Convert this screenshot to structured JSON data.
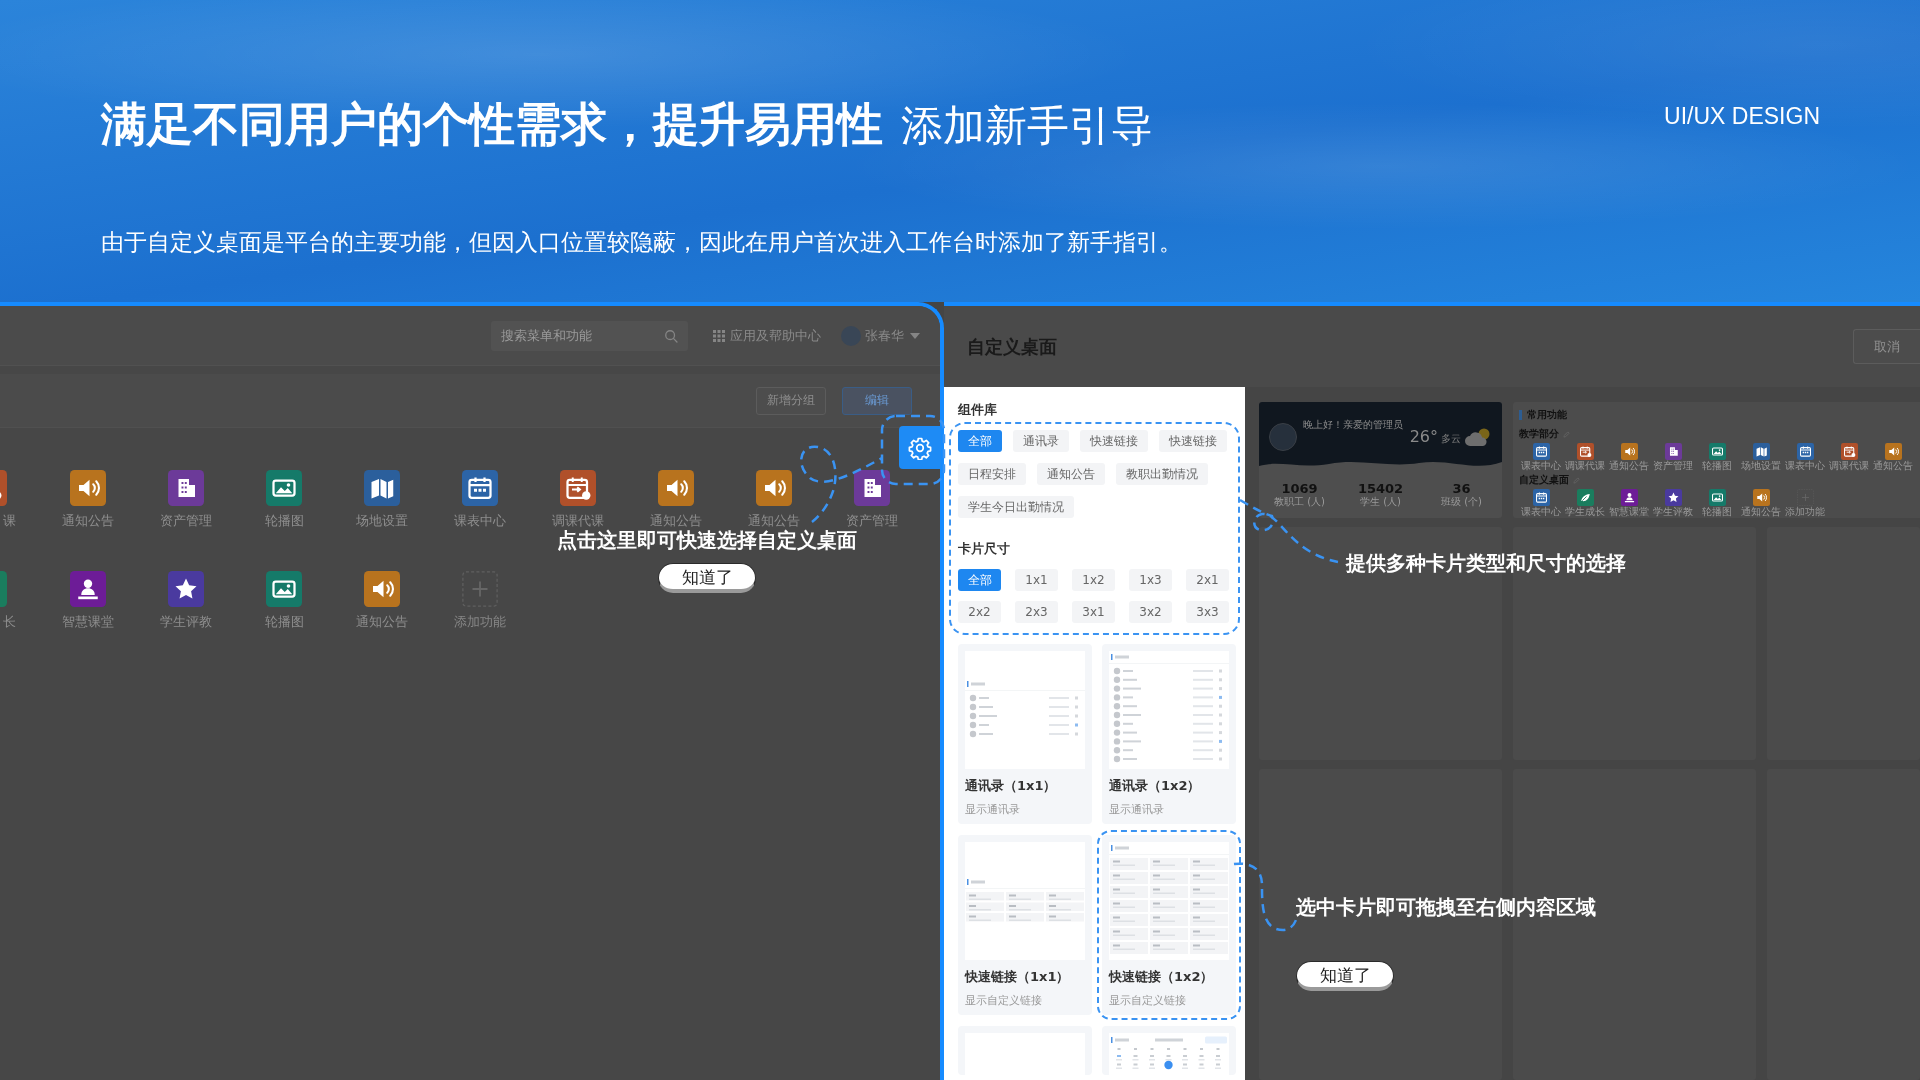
{
  "header": {
    "title": "满足不同用户的个性需求，提升易用性",
    "subtitle": "添加新手引导",
    "tagline": "UI/UX DESIGN",
    "description": "由于自定义桌面是平台的主要功能，但因入口位置较隐蔽，因此在用户首次进入工作台时添加了新手指引。"
  },
  "workbench": {
    "search": {
      "placeholder": "搜索菜单和功能"
    },
    "help_center": "应用及帮助中心",
    "user_name": "张春华",
    "buttons": [
      {
        "label": "新增分组",
        "kind": "default"
      },
      {
        "label": "编辑",
        "kind": "primary"
      }
    ],
    "app_rows": [
      {
        "cut_item": {
          "label": "课",
          "kind": "swap",
          "color": "#b0502a"
        },
        "apps": [
          {
            "label": "通知公告",
            "kind": "speaker",
            "color": "#b8731e"
          },
          {
            "label": "资产管理",
            "kind": "building",
            "color": "#6c3a99"
          },
          {
            "label": "轮播图",
            "kind": "image",
            "color": "#157a69"
          },
          {
            "label": "场地设置",
            "kind": "venue",
            "color": "#2b5f9c"
          },
          {
            "label": "课表中心",
            "kind": "calendar",
            "color": "#2c64a6"
          },
          {
            "label": "调课代课",
            "kind": "swap",
            "color": "#b0502a"
          },
          {
            "label": "通知公告",
            "kind": "speaker",
            "color": "#b8731e"
          },
          {
            "label": "通知公告",
            "kind": "speaker",
            "color": "#b8731e"
          },
          {
            "label": "资产管理",
            "kind": "building",
            "color": "#6c3a99"
          }
        ]
      },
      {
        "cut_item": {
          "label": "长",
          "kind": "growth",
          "color": "#1a7d5e"
        },
        "apps": [
          {
            "label": "智慧课堂",
            "kind": "presenter",
            "color": "#6d1c97"
          },
          {
            "label": "学生评教",
            "kind": "star",
            "color": "#4a3a9f"
          },
          {
            "label": "轮播图",
            "kind": "image",
            "color": "#157a69"
          },
          {
            "label": "通知公告",
            "kind": "speaker",
            "color": "#b8731e"
          },
          {
            "label": "添加功能",
            "kind": "add"
          }
        ]
      }
    ],
    "guide": {
      "text": "点击这里即可快速选择自定义桌面",
      "button": "知道了"
    }
  },
  "customize": {
    "title": "自定义桌面",
    "cancel": "取消",
    "library": {
      "title": "组件库",
      "type_tags": [
        {
          "label": "全部",
          "selected": true
        },
        {
          "label": "通讯录",
          "selected": false
        },
        {
          "label": "快速链接",
          "selected": false
        },
        {
          "label": "快速链接",
          "selected": false
        },
        {
          "label": "日程安排",
          "selected": false
        },
        {
          "label": "通知公告",
          "selected": false
        },
        {
          "label": "教职出勤情况",
          "selected": false
        },
        {
          "label": "学生今日出勤情况",
          "selected": false
        }
      ],
      "size_title": "卡片尺寸",
      "size_tags": [
        {
          "label": "全部",
          "selected": true
        },
        {
          "label": "1x1",
          "selected": false
        },
        {
          "label": "1x2",
          "selected": false
        },
        {
          "label": "1x3",
          "selected": false
        },
        {
          "label": "2x1",
          "selected": false
        },
        {
          "label": "2x2",
          "selected": false
        },
        {
          "label": "2x3",
          "selected": false
        },
        {
          "label": "3x1",
          "selected": false
        },
        {
          "label": "3x2",
          "selected": false
        },
        {
          "label": "3x3",
          "selected": false
        }
      ],
      "cards": [
        {
          "kind": "contacts",
          "title": "通讯录（1x1）",
          "description": "显示通讯录",
          "selected": false
        },
        {
          "kind": "contactlist",
          "title": "通讯录（1x2）",
          "description": "显示通讯录",
          "selected": false
        },
        {
          "kind": "links",
          "title": "快速链接（1x1）",
          "description": "显示自定义链接",
          "selected": false
        },
        {
          "kind": "linkgrid",
          "title": "快速链接（1x2）",
          "description": "显示自定义链接",
          "selected": true
        },
        {
          "kind": "blank",
          "selected": false
        },
        {
          "kind": "calendar",
          "selected": false
        }
      ]
    },
    "welcome": {
      "greeting": "晚上好！亲爱的管理员",
      "temperature": "26°",
      "weather": "多云",
      "stats": [
        {
          "value": "1069",
          "label": "教职工 (人)"
        },
        {
          "value": "15402",
          "label": "学生 (人)"
        },
        {
          "value": "36",
          "label": "班级 (个)"
        }
      ]
    },
    "functions": {
      "title": "常用功能",
      "sections": [
        {
          "title": "教学部分",
          "apps": [
            {
              "label": "课表中心",
              "kind": "calendar",
              "color": "#2c64a6"
            },
            {
              "label": "调课代课",
              "kind": "swap",
              "color": "#b0502a"
            },
            {
              "label": "通知公告",
              "kind": "speaker",
              "color": "#b8731e"
            },
            {
              "label": "资产管理",
              "kind": "building",
              "color": "#6c3a99"
            },
            {
              "label": "轮播图",
              "kind": "image",
              "color": "#157a69"
            },
            {
              "label": "场地设置",
              "kind": "venue",
              "color": "#2b5f9c"
            },
            {
              "label": "课表中心",
              "kind": "calendar",
              "color": "#2c64a6"
            },
            {
              "label": "调课代课",
              "kind": "swap",
              "color": "#b0502a"
            },
            {
              "label": "通知公告",
              "kind": "speaker",
              "color": "#b8731e"
            }
          ]
        },
        {
          "title": "自定义桌面",
          "apps": [
            {
              "label": "课表中心",
              "kind": "calendar",
              "color": "#2c64a6"
            },
            {
              "label": "学生成长",
              "kind": "growth",
              "color": "#1a7d5e"
            },
            {
              "label": "智慧课堂",
              "kind": "presenter",
              "color": "#6d1c97"
            },
            {
              "label": "学生评教",
              "kind": "star",
              "color": "#4a3a9f"
            },
            {
              "label": "轮播图",
              "kind": "image",
              "color": "#157a69"
            },
            {
              "label": "通知公告",
              "kind": "speaker",
              "color": "#b8731e"
            },
            {
              "label": "添加功能",
              "kind": "add"
            }
          ]
        }
      ]
    },
    "guides": [
      {
        "text": "提供多种卡片类型和尺寸的选择"
      },
      {
        "text": "选中卡片即可拖拽至右侧内容区域",
        "button": "知道了"
      }
    ]
  }
}
